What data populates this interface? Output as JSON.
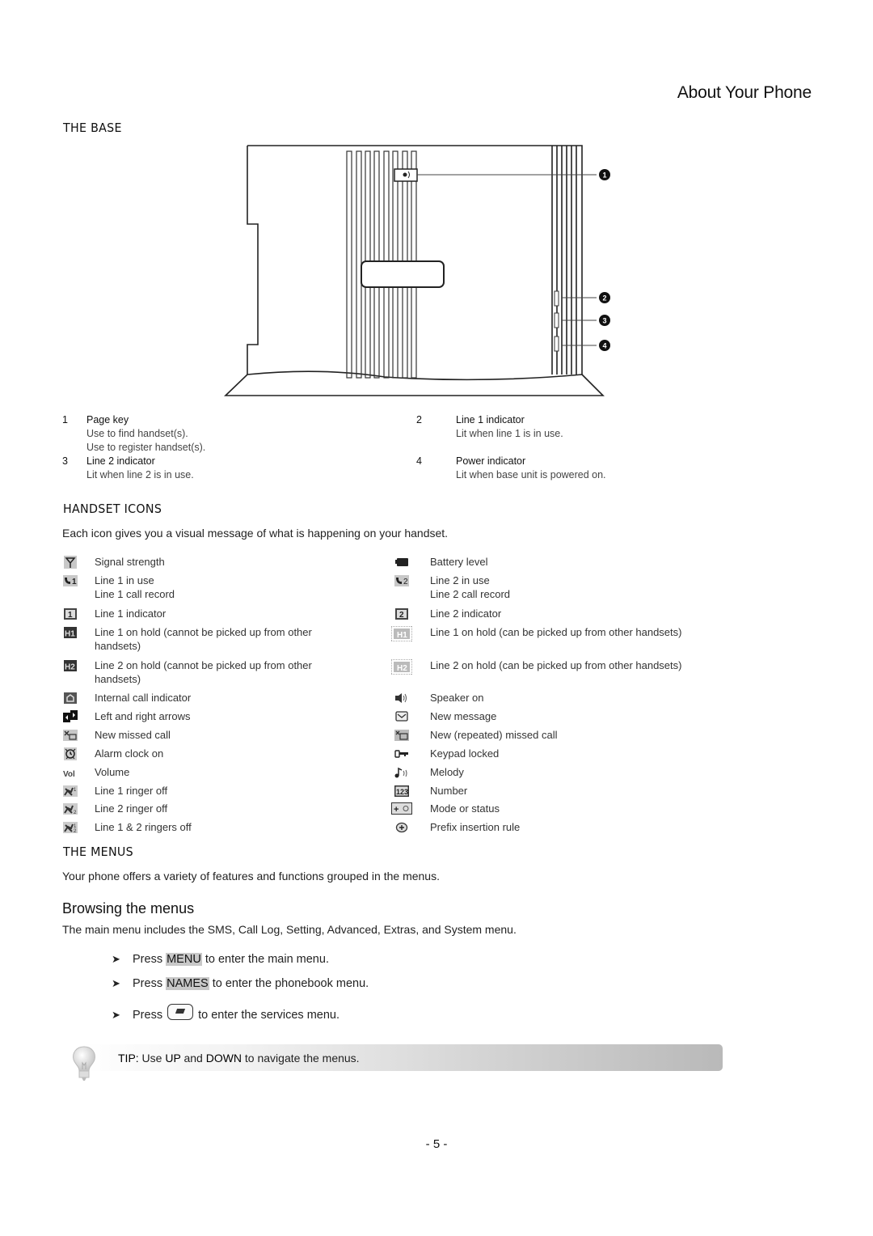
{
  "header": {
    "title": "About Your Phone"
  },
  "base": {
    "heading": "THE BASE",
    "callouts": [
      "1",
      "2",
      "3",
      "4"
    ],
    "legend": [
      {
        "num": "1",
        "title": "Page key",
        "desc": [
          "Use to find handset(s).",
          "Use to register handset(s)."
        ]
      },
      {
        "num": "2",
        "title": "Line 1 indicator",
        "desc": [
          "Lit when line 1 is in use."
        ]
      },
      {
        "num": "3",
        "title": "Line 2 indicator",
        "desc": [
          "Lit when line 2 is in use."
        ]
      },
      {
        "num": "4",
        "title": "Power indicator",
        "desc": [
          "Lit when base unit is powered on."
        ]
      }
    ]
  },
  "handset_icons": {
    "heading": "HANDSET ICONS",
    "intro": "Each icon gives you a visual message of what is happening on your handset.",
    "left": [
      {
        "icon": "signal-strength-icon",
        "label": "Signal strength"
      },
      {
        "icon": "line1-in-use-icon",
        "label": "Line 1 in use",
        "label2": "Line 1 call record"
      },
      {
        "icon": "line1-indicator-icon",
        "label": "Line 1 indicator"
      },
      {
        "icon": "line1-hold-icon",
        "label": "Line 1 on hold (cannot be picked up from other handsets)"
      },
      {
        "icon": "line2-hold-icon",
        "label": "Line 2 on hold (cannot be picked up from other handsets)"
      },
      {
        "icon": "internal-call-icon",
        "label": "Internal call indicator"
      },
      {
        "icon": "left-right-arrows-icon",
        "label": "Left and right arrows"
      },
      {
        "icon": "missed-call-icon",
        "label": "New missed call"
      },
      {
        "icon": "alarm-clock-icon",
        "label": "Alarm clock on"
      },
      {
        "icon": "volume-icon",
        "label": "Volume"
      },
      {
        "icon": "line1-ringer-off-icon",
        "label": "Line 1 ringer off"
      },
      {
        "icon": "line2-ringer-off-icon",
        "label": "Line 2 ringer off"
      },
      {
        "icon": "both-ringers-off-icon",
        "label": "Line 1 & 2 ringers off"
      }
    ],
    "right": [
      {
        "icon": "battery-icon",
        "label": "Battery level"
      },
      {
        "icon": "line2-in-use-icon",
        "label": "Line 2 in use",
        "label2": "Line 2 call record"
      },
      {
        "icon": "line2-indicator-icon",
        "label": "Line 2 indicator"
      },
      {
        "icon": "line1-hold-shared-icon",
        "label": "Line 1 on hold (can be picked up from other handsets)"
      },
      {
        "icon": "line2-hold-shared-icon",
        "label": "Line 2 on hold (can be picked up from other handsets)"
      },
      {
        "icon": "speaker-icon",
        "label": "Speaker on"
      },
      {
        "icon": "envelope-icon",
        "label": "New message"
      },
      {
        "icon": "repeated-missed-call-icon",
        "label": "New (repeated) missed call"
      },
      {
        "icon": "key-icon",
        "label": "Keypad locked"
      },
      {
        "icon": "melody-icon",
        "label": "Melody"
      },
      {
        "icon": "number-icon",
        "label": "Number"
      },
      {
        "icon": "mode-status-icon",
        "label": "Mode or status"
      },
      {
        "icon": "prefix-rule-icon",
        "label": "Prefix insertion rule"
      }
    ]
  },
  "menus": {
    "heading": "THE MENUS",
    "intro": "Your phone offers a variety of features and functions grouped in the menus.",
    "browsing": {
      "heading": "Browsing the menus",
      "intro": "The main menu includes the SMS, Call Log, Setting, Advanced, Extras, and System menu.",
      "bullets": [
        {
          "pre": "Press ",
          "key": "MENU",
          "post": " to enter the main menu."
        },
        {
          "pre": "Press ",
          "key": "NAMES",
          "post": " to enter the phonebook menu."
        },
        {
          "pre": "Press ",
          "key": "",
          "post": " to enter the services menu."
        }
      ]
    }
  },
  "tip": {
    "label": "TIP:",
    "pre": " Use ",
    "k1": "UP",
    "mid": " and ",
    "k2": "DOWN",
    "post": " to navigate the menus."
  },
  "page_number": "- 5 -"
}
